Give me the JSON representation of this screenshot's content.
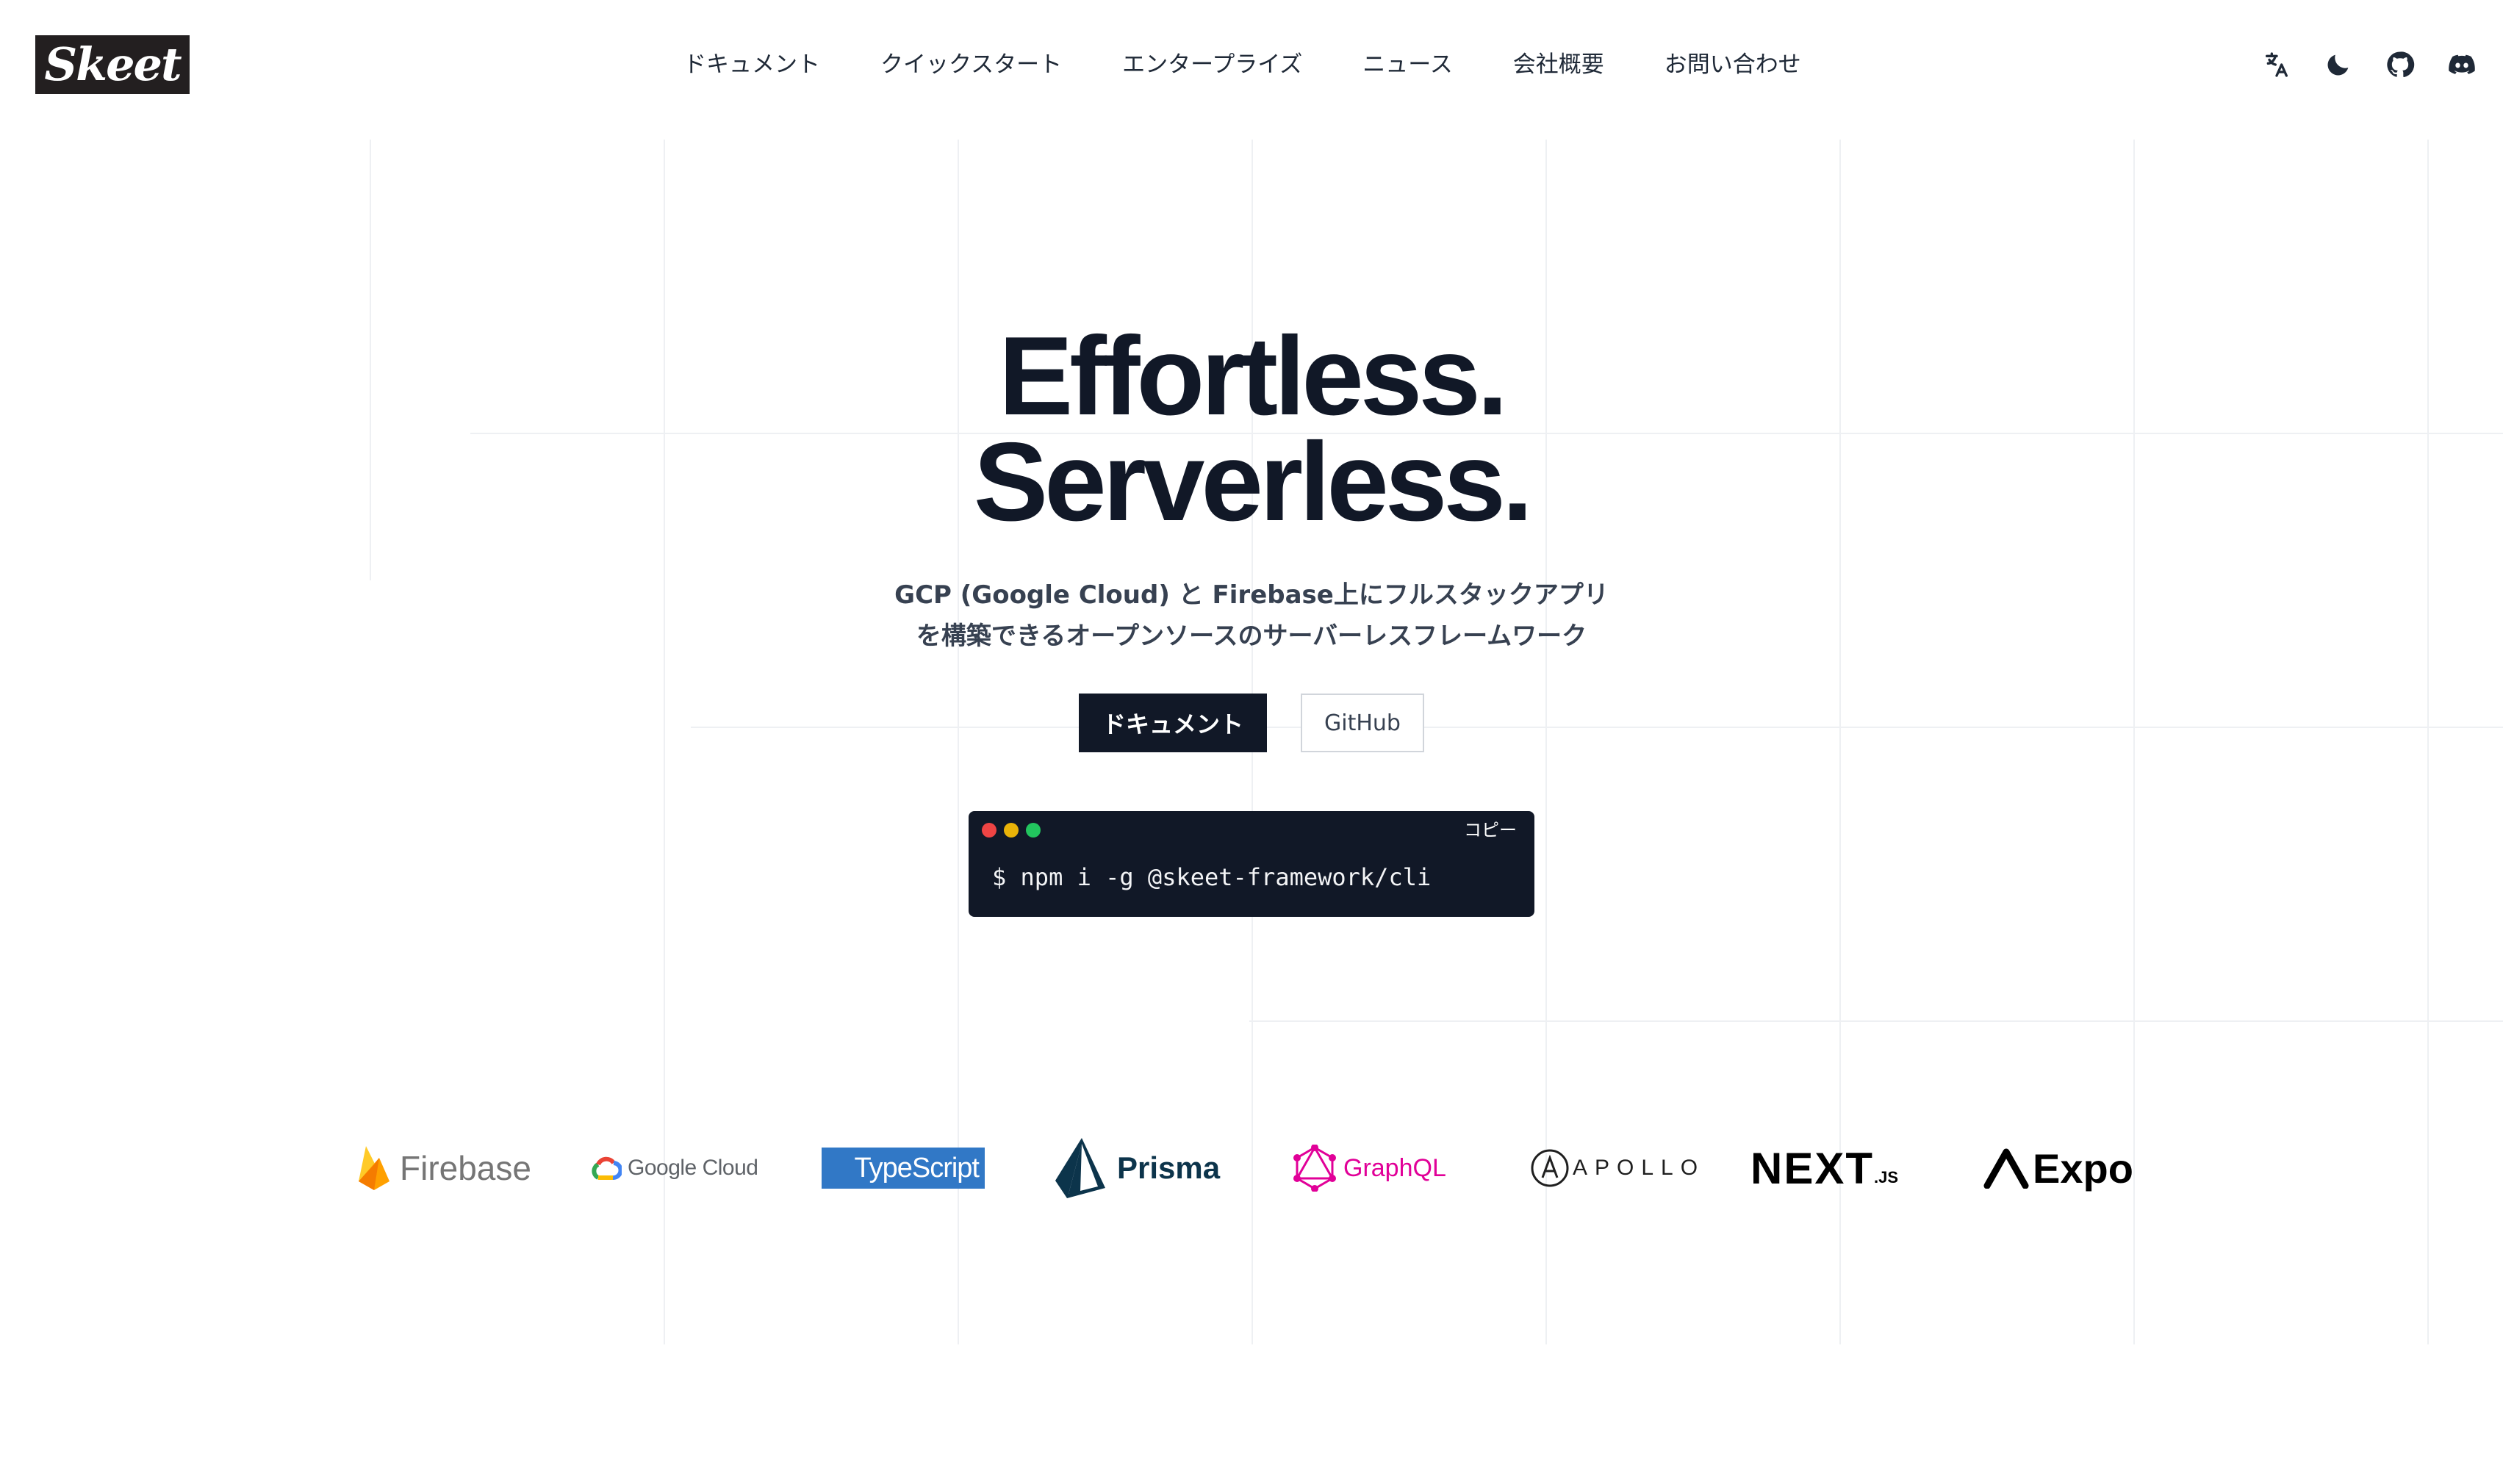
{
  "header": {
    "logo": "Skeet",
    "nav": [
      "ドキュメント",
      "クイックスタート",
      "エンタープライズ",
      "ニュース",
      "会社概要",
      "お問い合わせ"
    ],
    "icons": [
      "translate-icon",
      "moon-icon",
      "github-icon",
      "discord-icon"
    ]
  },
  "hero": {
    "title_line1": "Effortless.",
    "title_line2": "Serverless.",
    "subtitle_line1": "GCP (Google Cloud) と Firebase上にフルスタックアプリ",
    "subtitle_line2": "を構築できるオープンソースのサーバーレスフレームワーク",
    "primary_button": "ドキュメント",
    "secondary_button": "GitHub"
  },
  "terminal": {
    "copy_label": "コピー",
    "command": "$ npm i -g @skeet-framework/cli",
    "dot_colors": [
      "#ef4444",
      "#eab308",
      "#22c55e"
    ]
  },
  "logos": {
    "firebase": "Firebase",
    "google_cloud": "Google Cloud",
    "typescript": "TypeScript",
    "prisma": "Prisma",
    "graphql": "GraphQL",
    "apollo": "APOLLO",
    "nextjs": "NEXT",
    "nextjs_suffix": ".JS",
    "expo": "Expo"
  },
  "colors": {
    "dark": "#111827",
    "typescript_blue": "#3178c6",
    "graphql_pink": "#e10098",
    "prisma_dark": "#0c344b",
    "firebase_orange": "#ffa000"
  }
}
